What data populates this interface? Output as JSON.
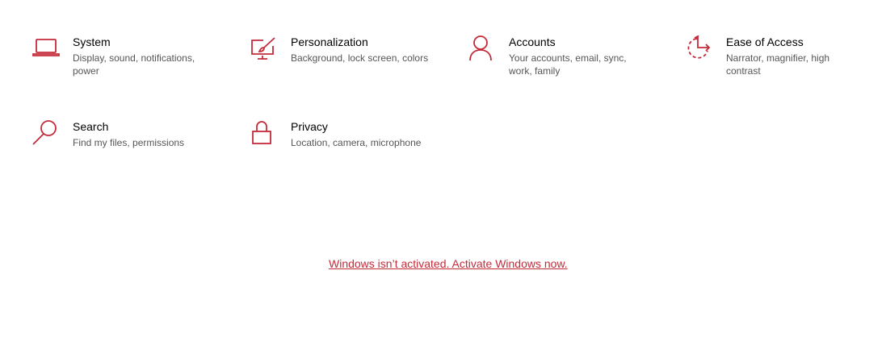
{
  "accent": "#c42b3a",
  "tiles": [
    {
      "title": "System",
      "desc_line1": "Display, sound, notifications,",
      "desc_line2": "power",
      "icon": "laptop-icon"
    },
    {
      "title": "Personalization",
      "desc_line1": "Background, lock screen, colors",
      "desc_line2": "",
      "icon": "paint-icon"
    },
    {
      "title": "Accounts",
      "desc_line1": "Your accounts, email, sync,",
      "desc_line2": "work, family",
      "icon": "person-icon"
    },
    {
      "title": "Ease of Access",
      "desc_line1": "Narrator, magnifier, high",
      "desc_line2": "contrast",
      "icon": "ease-of-access-icon"
    },
    {
      "title": "Search",
      "desc_line1": "Find my files, permissions",
      "desc_line2": "",
      "icon": "search-icon"
    },
    {
      "title": "Privacy",
      "desc_line1": "Location, camera, microphone",
      "desc_line2": "",
      "icon": "lock-icon"
    }
  ],
  "activation_link": "Windows isn’t activated. Activate Windows now."
}
